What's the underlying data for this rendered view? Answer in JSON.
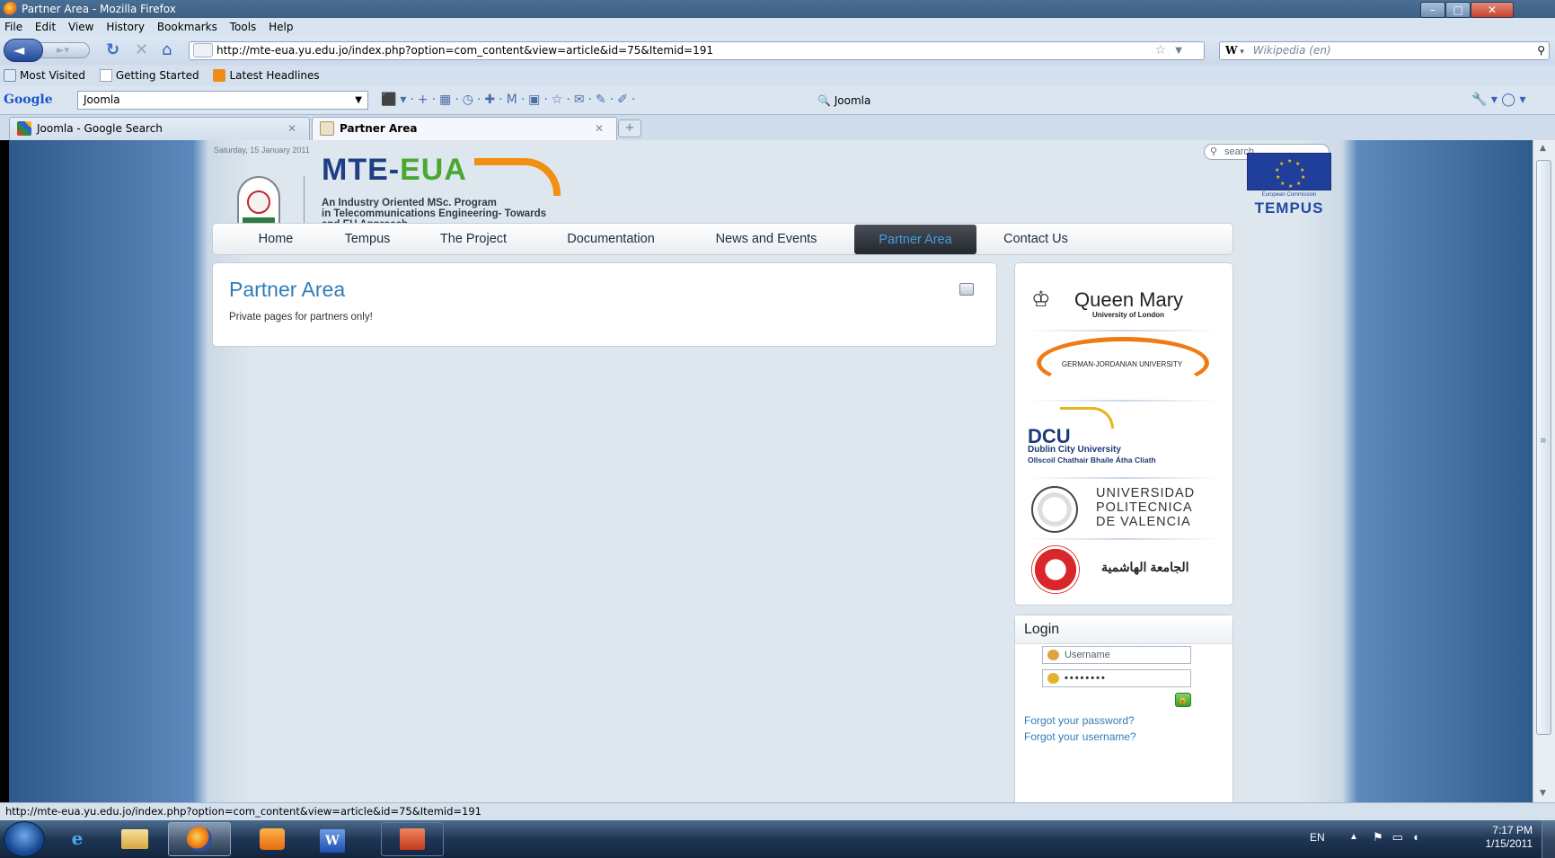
{
  "window": {
    "title": "Partner Area - Mozilla Firefox",
    "min": "–",
    "max": "□",
    "close": "✕"
  },
  "menubar": [
    "File",
    "Edit",
    "View",
    "History",
    "Bookmarks",
    "Tools",
    "Help"
  ],
  "nav": {
    "url": "http://mte-eua.yu.edu.jo/index.php?option=com_content&view=article&id=75&Itemid=191",
    "search_engine": "W",
    "search_placeholder": "Wikipedia (en)"
  },
  "bookmarks": [
    "Most Visited",
    "Getting Started",
    "Latest Headlines"
  ],
  "google_toolbar": {
    "logo": "Google",
    "query": "Joomla",
    "quick_search": "Joomla"
  },
  "tabs": [
    {
      "label": "Joomla - Google Search"
    },
    {
      "label": "Partner Area"
    }
  ],
  "page": {
    "date": "Saturday, 15 January 2011",
    "search_placeholder": "search...",
    "logo": {
      "title_a": "MTE-",
      "title_b": "EUA",
      "sub1": "An Industry Oriented MSc. Program",
      "sub2": "in Telecommunications Engineering- Towards",
      "sub3": "and EU Approach"
    },
    "tempus": {
      "ec": "European Commission",
      "name": "TEMPUS"
    },
    "menu": [
      "Home",
      "Tempus",
      "The Project",
      "Documentation",
      "News and Events",
      "Partner Area",
      "Contact Us"
    ],
    "article": {
      "title": "Partner Area",
      "text": "Private pages for partners only!"
    },
    "partners": {
      "qm_name": "Queen Mary",
      "qm_sub": "University of London",
      "gju_name": "GERMAN-JORDANIAN UNIVERSITY",
      "dcu_name": "DCU",
      "dcu_sub1": "Dublin City University",
      "dcu_sub2": "Ollscoil Chathair Bhaile Átha Cliath",
      "upv_l1": "UNIVERSIDAD",
      "upv_l2": "POLITECNICA",
      "upv_l3": "DE VALENCIA",
      "hu_name": "الجامعة الهاشمية"
    },
    "login": {
      "title": "Login",
      "username_placeholder": "Username",
      "password_mask": "••••••••",
      "forgot_password": "Forgot your password?",
      "forgot_username": "Forgot your username?"
    }
  },
  "statusbar": "http://mte-eua.yu.edu.jo/index.php?option=com_content&view=article&id=75&Itemid=191",
  "tray": {
    "lang": "EN",
    "time": "7:17 PM",
    "date": "1/15/2011"
  }
}
